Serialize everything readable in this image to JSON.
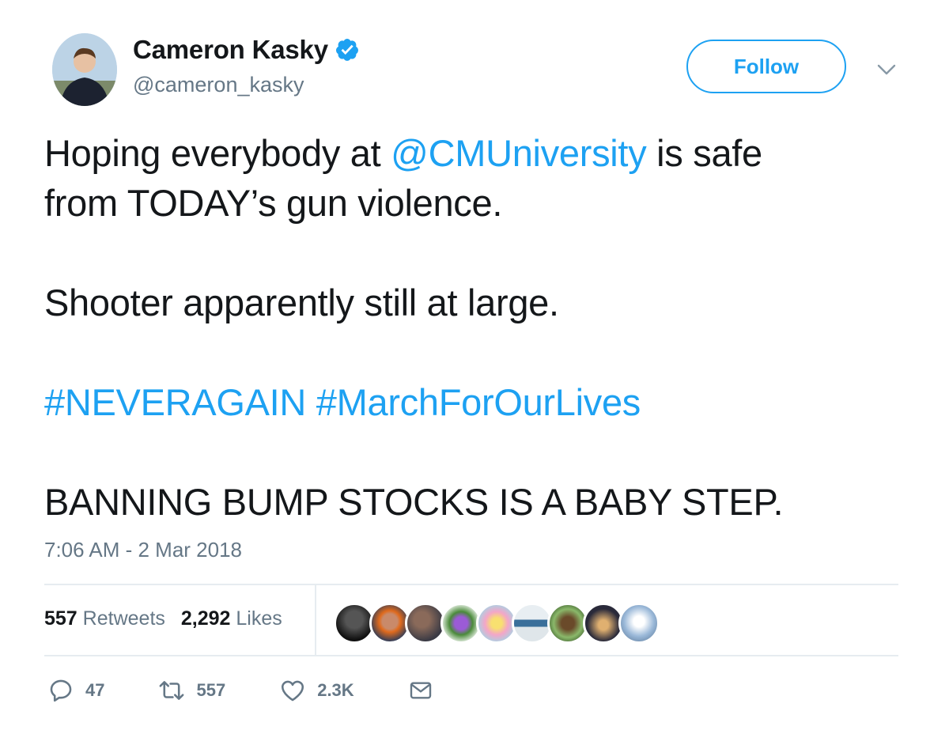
{
  "author": {
    "name": "Cameron Kasky",
    "handle": "@cameron_kasky",
    "verified": true
  },
  "follow_label": "Follow",
  "tweet": {
    "line1_pre": "Hoping everybody at ",
    "line1_mention": "@CMUniversity",
    "line1_post": " is safe",
    "line2": "from TODAY’s gun violence.",
    "line3": "Shooter apparently still at large.",
    "hashtag1": "#NEVERAGAIN",
    "hashtag2": "#MarchForOurLives",
    "line5": "BANNING BUMP STOCKS IS A BABY STEP."
  },
  "timestamp": "7:06 AM - 2 Mar 2018",
  "stats": {
    "retweets_count": "557",
    "retweets_label": "Retweets",
    "likes_count": "2,292",
    "likes_label": "Likes"
  },
  "actions": {
    "replies": "47",
    "retweets": "557",
    "likes": "2.3K"
  },
  "colors": {
    "accent": "#1da1f2",
    "text": "#14171a",
    "muted": "#657786",
    "divider": "#e6ecf0"
  },
  "icons": {
    "verified": "verified-badge-icon",
    "caret": "chevron-down-icon",
    "reply": "reply-icon",
    "retweet": "retweet-icon",
    "like": "heart-icon",
    "dm": "envelope-icon"
  }
}
